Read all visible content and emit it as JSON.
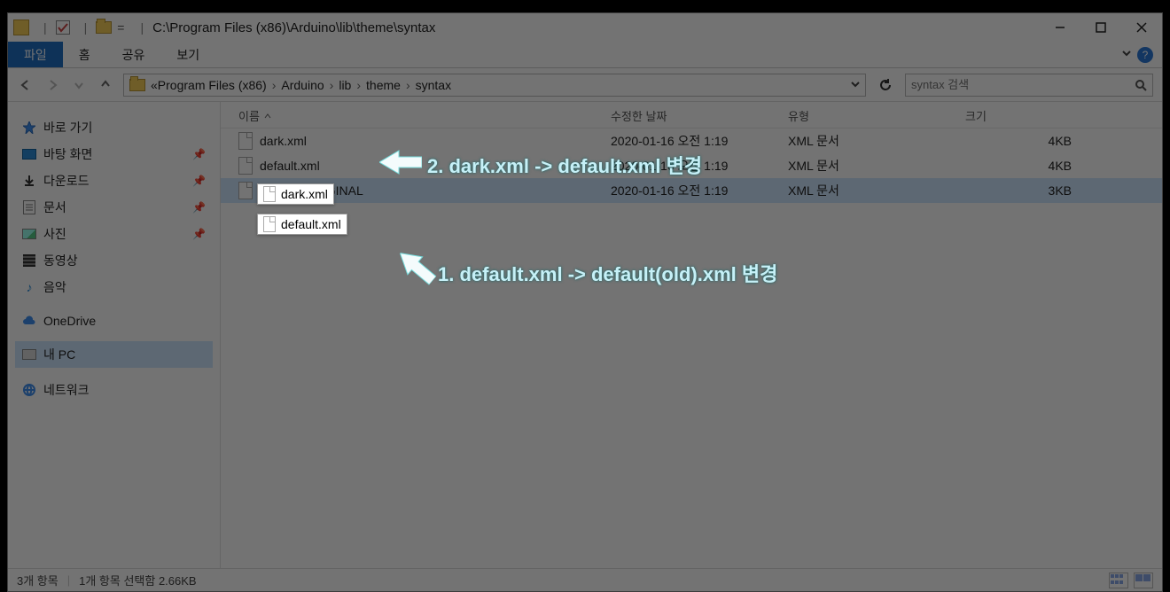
{
  "title": {
    "path": "C:\\Program Files (x86)\\Arduino\\lib\\theme\\syntax"
  },
  "winbuttons": {
    "min": "minimize",
    "max": "maximize",
    "close": "close"
  },
  "ribbon": {
    "file": "파일",
    "home": "홈",
    "share": "공유",
    "view": "보기"
  },
  "breadcrumbs": {
    "prefix": "«",
    "items": [
      "Program Files (x86)",
      "Arduino",
      "lib",
      "theme",
      "syntax"
    ]
  },
  "search": {
    "placeholder": "syntax 검색"
  },
  "sidebar": {
    "quick": "바로 가기",
    "desktop": "바탕 화면",
    "downloads": "다운로드",
    "documents": "문서",
    "pictures": "사진",
    "videos": "동영상",
    "music": "음악",
    "onedrive": "OneDrive",
    "thispc": "내 PC",
    "network": "네트워크"
  },
  "columns": {
    "name": "이름",
    "date": "수정한 날짜",
    "type": "유형",
    "size": "크기"
  },
  "files": [
    {
      "name": "dark.xml",
      "date": "2020-01-16 오전 1:19",
      "type": "XML 문서",
      "size": "4KB"
    },
    {
      "name": "default.xml",
      "date": "2020-01-16 오전 1:19",
      "type": "XML 문서",
      "size": "4KB"
    },
    {
      "name": "default_ORIGINAL",
      "date": "2020-01-16 오전 1:19",
      "type": "XML 문서",
      "size": "3KB"
    }
  ],
  "status": {
    "count": "3개 항목",
    "selected": "1개 항목 선택함 2.66KB"
  },
  "anno1": "2. dark.xml -> default.xml 변경",
  "anno2": "1. default.xml -> default(old).xml 변경",
  "highlight1": "dark.xml",
  "highlight2": "default.xml"
}
